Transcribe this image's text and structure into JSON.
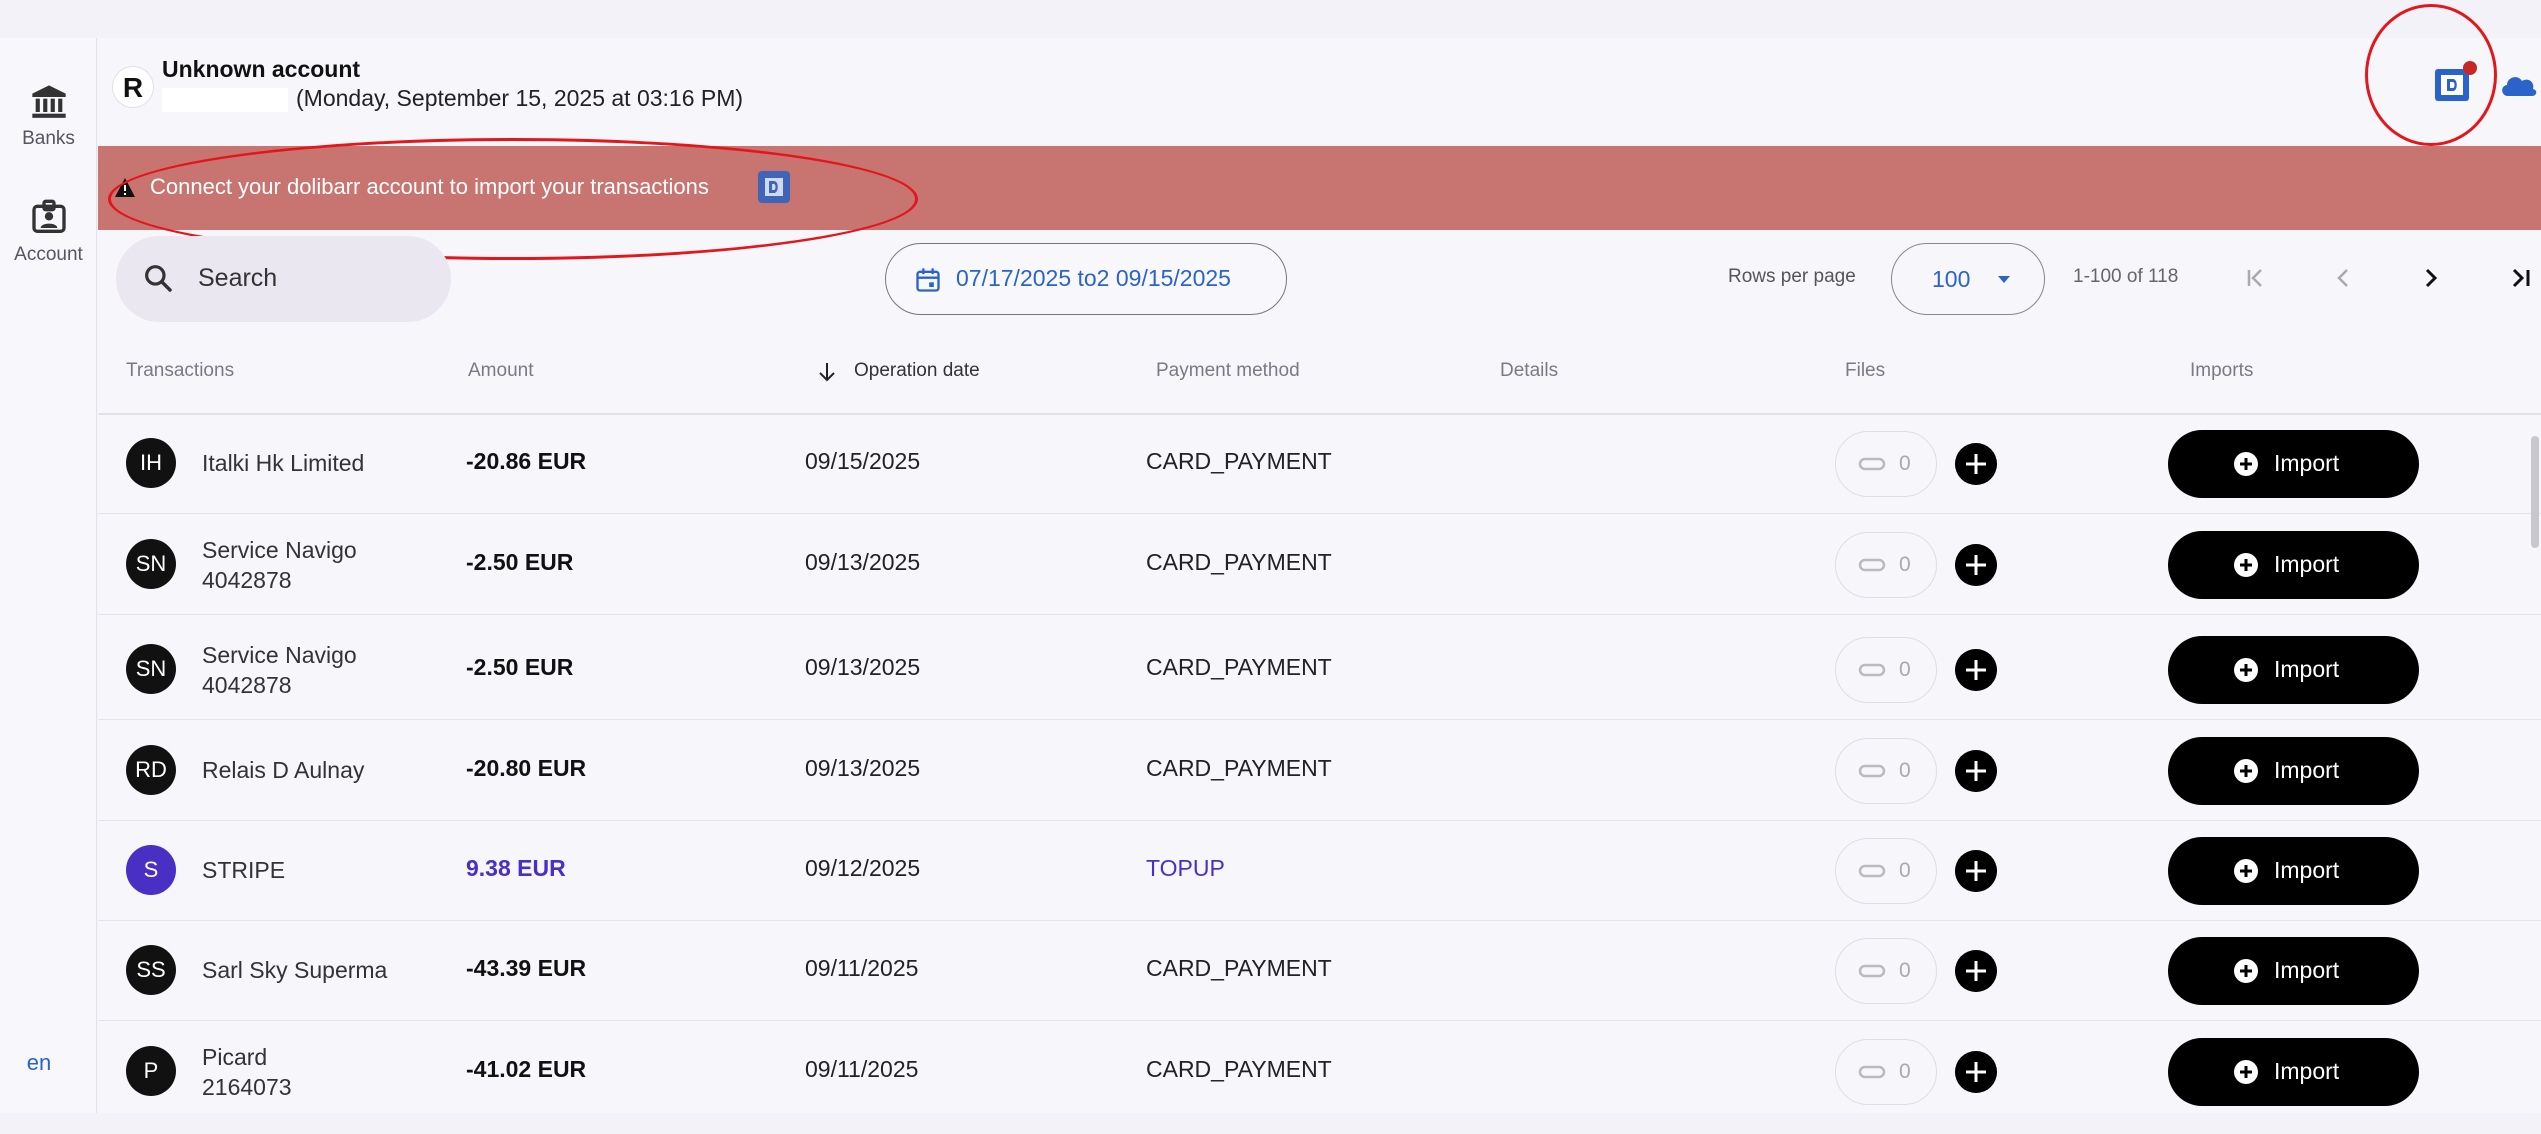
{
  "sidebar": {
    "items": [
      {
        "label": "Banks",
        "icon": "bank-icon"
      },
      {
        "label": "Account",
        "icon": "account-icon"
      }
    ],
    "language": "en"
  },
  "header": {
    "avatar_letter": "R",
    "account_title": "Unknown account",
    "account_date": "(Monday, September 15, 2025 at 03:16 PM)"
  },
  "banner": {
    "text": "Connect your dolibarr account to import your transactions"
  },
  "toolbar": {
    "search_placeholder": "Search",
    "date_range": "07/17/2025 to2 09/15/2025",
    "rows_per_page_label": "Rows per page",
    "rows_per_page_value": "100",
    "range_text": "1-100 of 118"
  },
  "table": {
    "headers": [
      "Transactions",
      "Amount",
      "Operation date",
      "Payment method",
      "Details",
      "Files",
      "Imports"
    ],
    "import_label": "Import",
    "rows": [
      {
        "initials": "IH",
        "name": "Italki Hk Limited",
        "sub": "",
        "amount": "-20.86 EUR",
        "date": "09/15/2025",
        "method": "CARD_PAYMENT",
        "files": "0"
      },
      {
        "initials": "SN",
        "name": "Service Navigo",
        "sub": "4042878",
        "amount": "-2.50 EUR",
        "date": "09/13/2025",
        "method": "CARD_PAYMENT",
        "files": "0"
      },
      {
        "initials": "SN",
        "name": "Service Navigo",
        "sub": "4042878",
        "amount": "-2.50 EUR",
        "date": "09/13/2025",
        "method": "CARD_PAYMENT",
        "files": "0"
      },
      {
        "initials": "RD",
        "name": "Relais D Aulnay",
        "sub": "",
        "amount": "-20.80 EUR",
        "date": "09/13/2025",
        "method": "CARD_PAYMENT",
        "files": "0"
      },
      {
        "initials": "S",
        "name": "STRIPE",
        "sub": "",
        "amount": "9.38 EUR",
        "date": "09/12/2025",
        "method": "TOPUP",
        "files": "0"
      },
      {
        "initials": "SS",
        "name": "Sarl Sky Superma",
        "sub": "",
        "amount": "-43.39 EUR",
        "date": "09/11/2025",
        "method": "CARD_PAYMENT",
        "files": "0"
      },
      {
        "initials": "P",
        "name": "Picard",
        "sub": "2164073",
        "amount": "-41.02 EUR",
        "date": "09/11/2025",
        "method": "CARD_PAYMENT",
        "files": "0"
      }
    ]
  },
  "colors": {
    "accent": "#2a63c9",
    "banner": "#c87471",
    "positive": "#4a2fc4",
    "annotation": "#e3161b"
  }
}
